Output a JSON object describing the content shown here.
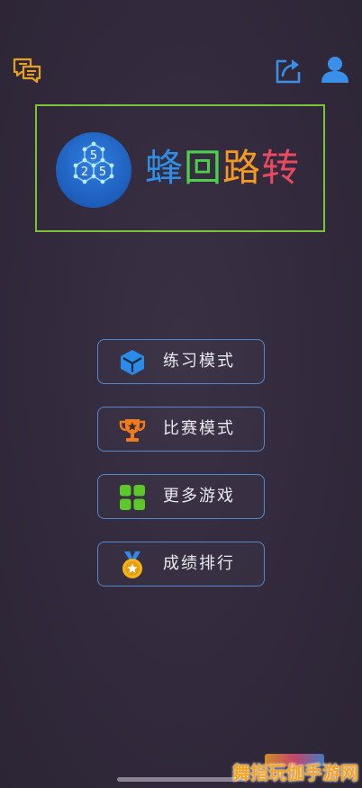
{
  "header": {
    "feedback_icon": "feedback-chat-icon",
    "share_icon": "share-icon",
    "user_icon": "user-profile-icon"
  },
  "logo": {
    "badge_numbers": [
      "5",
      "2",
      "5"
    ],
    "title_chars": [
      "蜂",
      "回",
      "路",
      "转"
    ],
    "title_colors": [
      "#2f8fe6",
      "#4cd04c",
      "#f09a25",
      "#e84a5f"
    ],
    "frame_color": "#7bc23a"
  },
  "menu": {
    "items": [
      {
        "label": "练习模式",
        "icon": "cube-icon"
      },
      {
        "label": "比赛模式",
        "icon": "trophy-icon"
      },
      {
        "label": "更多游戏",
        "icon": "grid-icon"
      },
      {
        "label": "成绩排行",
        "icon": "medal-icon"
      }
    ],
    "border_color": "#4f88d0"
  },
  "watermark": {
    "text": "舞指玩伽手游网"
  }
}
